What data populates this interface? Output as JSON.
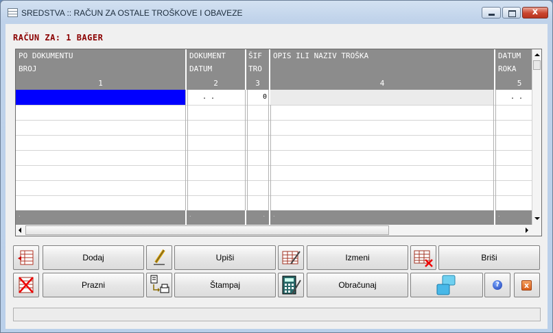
{
  "window": {
    "title": "SREDSTVA :: RAČUN ZA OSTALE TROŠKOVE I OBAVEZE",
    "close_symbol": "x"
  },
  "heading": "RAČUN ZA: 1 BAGER",
  "columns": [
    {
      "line1": "PO DOKUMENTU",
      "line2": "BROJ",
      "number": "1"
    },
    {
      "line1": "DOKUMENT",
      "line2": "DATUM",
      "number": "2"
    },
    {
      "line1": "ŠIF",
      "line2": "TRO",
      "number": "3"
    },
    {
      "line1": "OPIS ILI NAZIV TROŠKA",
      "line2": "",
      "number": "4"
    },
    {
      "line1": "DATUM",
      "line2": "ROKA",
      "number": "5"
    }
  ],
  "first_row": {
    "broj": "",
    "datum": ".  .",
    "sifra": "0",
    "opis": "",
    "datum_roka": ".  ."
  },
  "footer": {
    "c1": ".",
    "c2": ".",
    "c3": ".",
    "c4": ".",
    "c5": "."
  },
  "buttons": {
    "dodaj": "Dodaj",
    "upisi": "Upiši",
    "izmeni": "Izmeni",
    "brisi": "Briši",
    "prazni": "Prazni",
    "stampaj": "Štampaj",
    "obracunaj": "Obračunaj",
    "help_symbol": "?",
    "exit_symbol": "x"
  },
  "colors": {
    "selection": "#0000ff",
    "header_bg": "#8c8c8c",
    "heading_text": "#8b0000"
  }
}
